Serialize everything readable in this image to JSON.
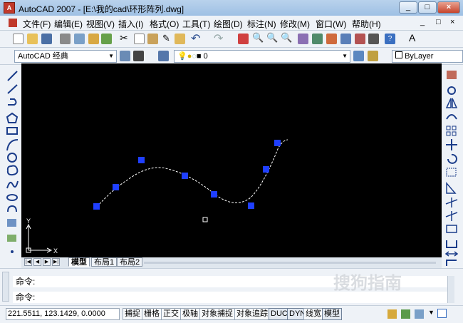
{
  "window": {
    "title": "AutoCAD 2007 - [E:\\我的cad\\环形阵列.dwg]",
    "buttons": [
      "_",
      "□",
      "×"
    ]
  },
  "menu": [
    "文件(F)",
    "编辑(E)",
    "视图(V)",
    "插入(I)",
    "格式(O)",
    "工具(T)",
    "绘图(D)",
    "标注(N)",
    "修改(M)",
    "窗口(W)",
    "帮助(H)"
  ],
  "toolbar2": {
    "workspace": "AutoCAD 经典",
    "layer": "0",
    "color": "ByLayer"
  },
  "layout_tabs": [
    "模型",
    "布局1",
    "布局2"
  ],
  "ucs": {
    "x_label": "X",
    "y_label": "Y"
  },
  "command": {
    "line1": "命令:",
    "line2": "命令:"
  },
  "status": {
    "coords": "221.5511,  123.1429,  0.0000",
    "buttons": [
      {
        "label": "捕捉",
        "on": false
      },
      {
        "label": "栅格",
        "on": false
      },
      {
        "label": "正交",
        "on": false
      },
      {
        "label": "极轴",
        "on": false
      },
      {
        "label": "对象捕捉",
        "on": false
      },
      {
        "label": "对象追踪",
        "on": false
      },
      {
        "label": "DUCS",
        "on": true
      },
      {
        "label": "DYN",
        "on": true
      },
      {
        "label": "线宽",
        "on": false
      },
      {
        "label": "模型",
        "on": true
      }
    ]
  },
  "watermark": "搜狗指南",
  "colors": {
    "canvas": "#000000",
    "grip": "#1f3fff",
    "curve": "#ffffff"
  }
}
